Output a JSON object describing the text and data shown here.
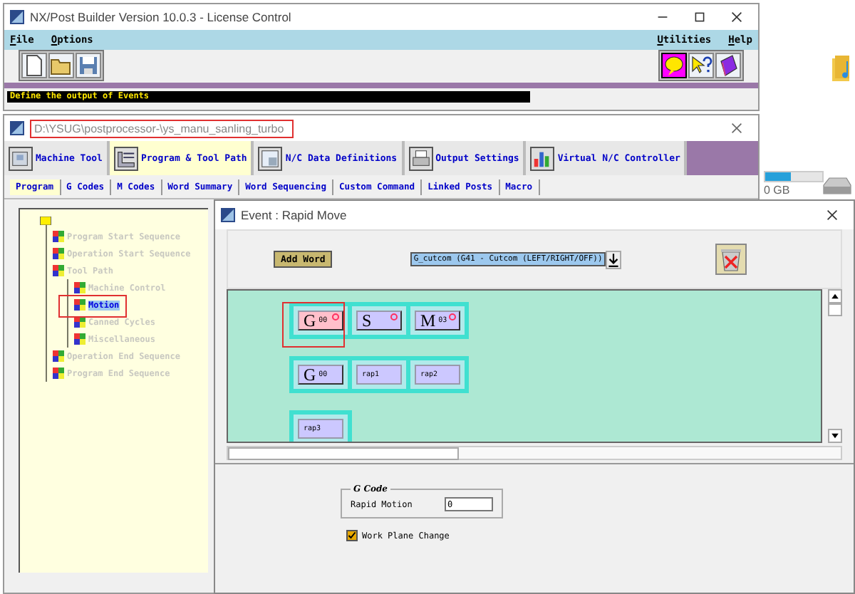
{
  "main_window": {
    "title": "NX/Post Builder Version 10.0.3 - License Control",
    "menus": [
      {
        "label": "File"
      },
      {
        "label": "Options"
      }
    ],
    "right_menus": [
      {
        "label": "Utilities"
      },
      {
        "label": "Help"
      }
    ],
    "tools": [
      {
        "kind": "new"
      },
      {
        "kind": "open"
      },
      {
        "kind": "save"
      }
    ],
    "help_tools": [
      {
        "kind": "balloon",
        "on": true
      },
      {
        "kind": "context",
        "on": false
      },
      {
        "kind": "manual",
        "on": false
      }
    ],
    "status": "Define the output of Events"
  },
  "project_window": {
    "title": "D:\\YSUG\\postprocessor-\\ys_manu_sanling_turbo",
    "tabs": [
      {
        "label": "Machine Tool",
        "kind": "machine",
        "selected": false
      },
      {
        "label": "Program & Tool Path",
        "kind": "program",
        "selected": true
      },
      {
        "label": "N/C Data Definitions",
        "kind": "data",
        "selected": false
      },
      {
        "label": "Output Settings",
        "kind": "printer",
        "selected": false
      },
      {
        "label": "Virtual N/C Controller",
        "kind": "chart",
        "selected": false
      }
    ],
    "subtabs": [
      {
        "label": "Program",
        "selected": true
      },
      {
        "label": "G Codes",
        "selected": false
      },
      {
        "label": "M Codes",
        "selected": false
      },
      {
        "label": "Word Summary",
        "selected": false
      },
      {
        "label": "Word Sequencing",
        "selected": false
      },
      {
        "label": "Custom Command",
        "selected": false
      },
      {
        "label": "Linked Posts",
        "selected": false
      },
      {
        "label": "Macro",
        "selected": false
      }
    ],
    "tree": [
      {
        "label": "Program Start Sequence",
        "selected": false
      },
      {
        "label": "Operation Start Sequence",
        "selected": false
      },
      {
        "label": "Tool Path",
        "selected": false,
        "children": [
          {
            "label": "Machine Control",
            "selected": false
          },
          {
            "label": "Motion",
            "selected": true
          },
          {
            "label": "Canned Cycles",
            "selected": false
          },
          {
            "label": "Miscellaneous",
            "selected": false
          }
        ]
      },
      {
        "label": "Operation End Sequence",
        "selected": false
      },
      {
        "label": "Program End Sequence",
        "selected": false
      }
    ]
  },
  "dialog": {
    "title": "Event : Rapid Move",
    "add_button": "Add Word",
    "word_choice": "G_cutcom (G41 - Cutcom (LEFT/RIGHT/OFF))",
    "blocks": [
      [
        {
          "kind": "letter",
          "letter": "G",
          "code": "00",
          "selected": true,
          "dot": true
        },
        {
          "kind": "letter",
          "letter": "S",
          "selected": false,
          "dot": true
        },
        {
          "kind": "letter",
          "letter": "M",
          "code": "03",
          "selected": false,
          "dot": true
        }
      ],
      [
        {
          "kind": "letter",
          "letter": "G",
          "code": "00",
          "selected": false,
          "dot": false
        },
        {
          "kind": "text",
          "label": "rap1",
          "selected": false,
          "dot": false
        },
        {
          "kind": "text",
          "label": "rap2",
          "selected": false,
          "dot": false
        }
      ],
      [
        {
          "kind": "text",
          "label": "rap3",
          "selected": false,
          "dot": false
        }
      ]
    ],
    "group_title": "G Code",
    "field_label": "Rapid Motion",
    "field_value": "0",
    "checkbox": {
      "label": "Work Plane Change",
      "checked": true
    }
  },
  "desktop": {
    "storage": "0 GB",
    "level": 0.45
  }
}
